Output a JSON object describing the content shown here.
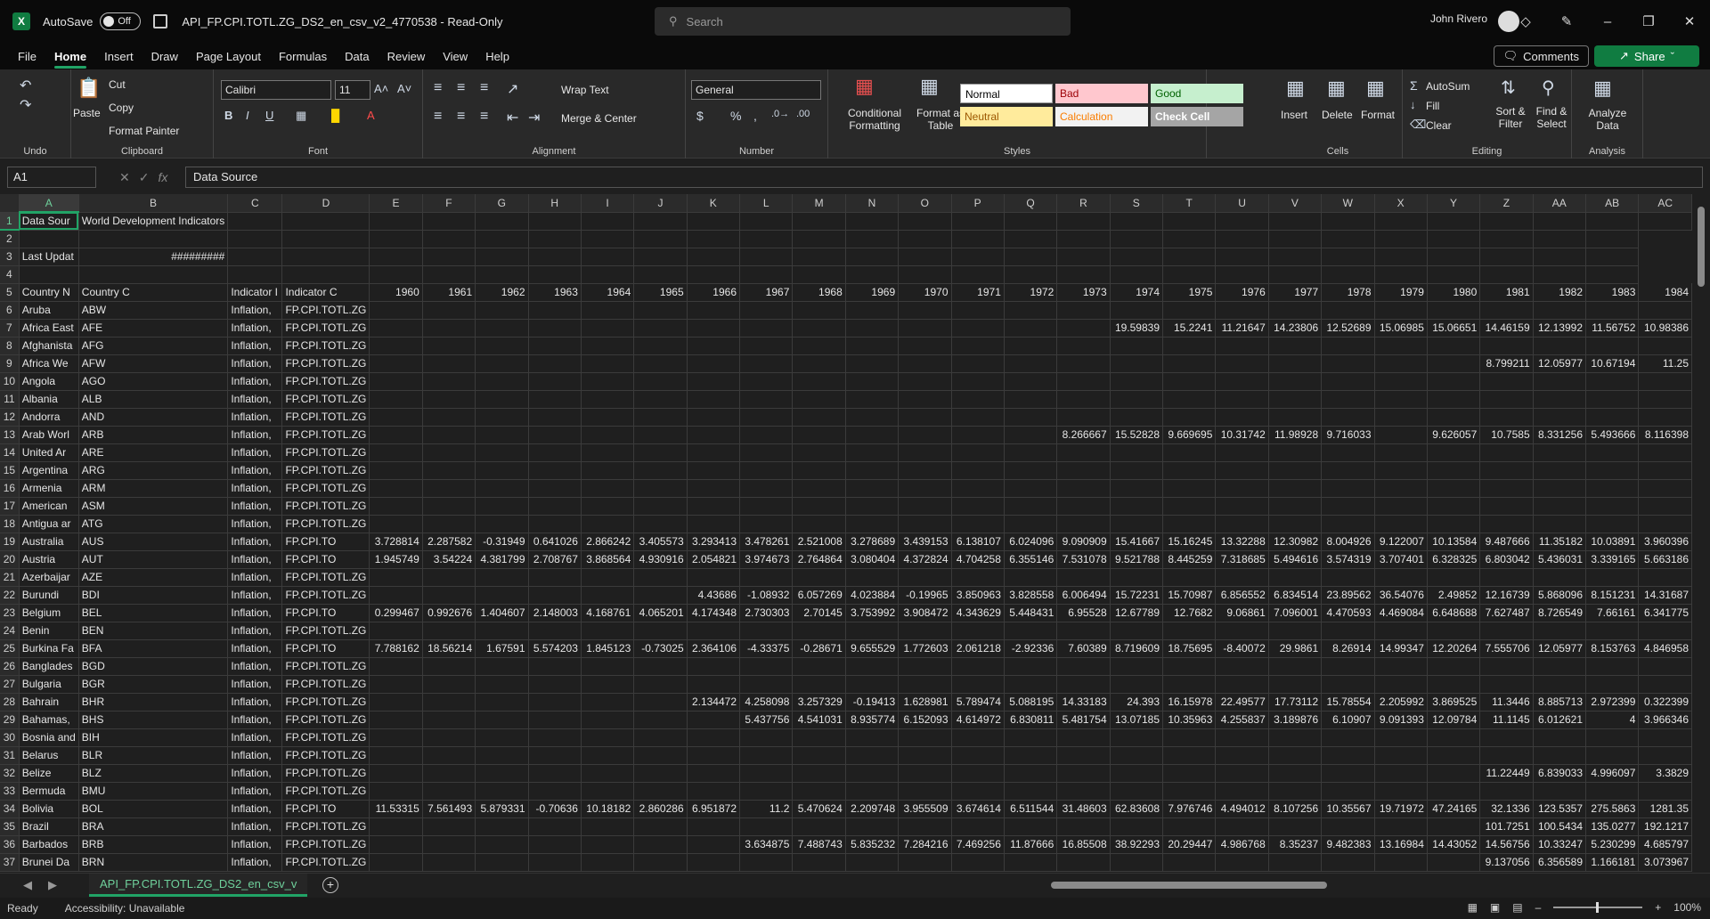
{
  "titlebar": {
    "autosave_label": "AutoSave",
    "autosave_state": "Off",
    "doc_title": "API_FP.CPI.TOTL.ZG_DS2_en_csv_v2_4770538  -  Read-Only",
    "search_placeholder": "Search",
    "user_name": "John Rivero"
  },
  "menu": {
    "tabs": [
      "File",
      "Home",
      "Insert",
      "Draw",
      "Page Layout",
      "Formulas",
      "Data",
      "Review",
      "View",
      "Help"
    ],
    "active": "Home",
    "comments_label": "Comments",
    "share_label": "Share"
  },
  "ribbon": {
    "undo_group": "Undo",
    "clipboard": {
      "paste": "Paste",
      "cut": "Cut",
      "copy": "Copy",
      "format_painter": "Format Painter",
      "label": "Clipboard"
    },
    "font": {
      "name": "Calibri",
      "size": "11",
      "label": "Font"
    },
    "alignment": {
      "wrap": "Wrap Text",
      "merge": "Merge & Center",
      "label": "Alignment"
    },
    "number": {
      "format": "General",
      "label": "Number"
    },
    "styles": {
      "conditional": "Conditional Formatting",
      "format_table": "Format as Table",
      "cells": [
        {
          "name": "Normal",
          "bg": "#ffffff",
          "fg": "#000000"
        },
        {
          "name": "Bad",
          "bg": "#ffc7ce",
          "fg": "#9c0006"
        },
        {
          "name": "Good",
          "bg": "#c6efce",
          "fg": "#006100"
        },
        {
          "name": "Neutral",
          "bg": "#ffeb9c",
          "fg": "#9c5700"
        },
        {
          "name": "Calculation",
          "bg": "#f2f2f2",
          "fg": "#fa7d00"
        },
        {
          "name": "Check Cell",
          "bg": "#a5a5a5",
          "fg": "#ffffff"
        }
      ],
      "label": "Styles"
    },
    "cells": {
      "insert": "Insert",
      "delete": "Delete",
      "format": "Format",
      "label": "Cells"
    },
    "editing": {
      "autosum": "AutoSum",
      "fill": "Fill",
      "clear": "Clear",
      "sort": "Sort & Filter",
      "find": "Find & Select",
      "label": "Editing"
    },
    "analysis": {
      "analyze": "Analyze Data",
      "label": "Analysis"
    }
  },
  "formula_bar": {
    "cell_ref": "A1",
    "content": "Data Source"
  },
  "sheet": {
    "columns": [
      "A",
      "B",
      "C",
      "D",
      "E",
      "F",
      "G",
      "H",
      "I",
      "J",
      "K",
      "L",
      "M",
      "N",
      "O",
      "P",
      "Q",
      "R",
      "S",
      "T",
      "U",
      "V",
      "W",
      "X",
      "Y",
      "Z",
      "AA",
      "AB",
      "AC"
    ],
    "rows": [
      [
        "1",
        "Data Sour",
        "World Development Indicators",
        "",
        "",
        "",
        "",
        "",
        "",
        "",
        "",
        "",
        "",
        "",
        "",
        "",
        "",
        "",
        "",
        "",
        "",
        "",
        "",
        "",
        "",
        "",
        "",
        "",
        "",
        ""
      ],
      [
        "2",
        "",
        "",
        "",
        "",
        "",
        "",
        "",
        "",
        "",
        "",
        "",
        "",
        "",
        "",
        "",
        "",
        "",
        "",
        "",
        "",
        "",
        "",
        "",
        "",
        "",
        "",
        "",
        ""
      ],
      [
        "3",
        "Last Updat",
        "#########",
        "",
        "",
        "",
        "",
        "",
        "",
        "",
        "",
        "",
        "",
        "",
        "",
        "",
        "",
        "",
        "",
        "",
        "",
        "",
        "",
        "",
        "",
        "",
        "",
        "",
        ""
      ],
      [
        "4",
        "",
        "",
        "",
        "",
        "",
        "",
        "",
        "",
        "",
        "",
        "",
        "",
        "",
        "",
        "",
        "",
        "",
        "",
        "",
        "",
        "",
        "",
        "",
        "",
        "",
        "",
        "",
        ""
      ],
      [
        "5",
        "Country N",
        "Country C",
        "Indicator I",
        "Indicator C",
        "1960",
        "1961",
        "1962",
        "1963",
        "1964",
        "1965",
        "1966",
        "1967",
        "1968",
        "1969",
        "1970",
        "1971",
        "1972",
        "1973",
        "1974",
        "1975",
        "1976",
        "1977",
        "1978",
        "1979",
        "1980",
        "1981",
        "1982",
        "1983",
        "1984"
      ],
      [
        "6",
        "Aruba",
        "ABW",
        "Inflation,",
        "FP.CPI.TOTL.ZG",
        "",
        "",
        "",
        "",
        "",
        "",
        "",
        "",
        "",
        "",
        "",
        "",
        "",
        "",
        "",
        "",
        "",
        "",
        "",
        "",
        "",
        "",
        "",
        "",
        ""
      ],
      [
        "7",
        "Africa East",
        "AFE",
        "Inflation,",
        "FP.CPI.TOTL.ZG",
        "",
        "",
        "",
        "",
        "",
        "",
        "",
        "",
        "",
        "",
        "",
        "",
        "",
        "",
        "19.59839",
        "15.2241",
        "11.21647",
        "14.23806",
        "12.52689",
        "15.06985",
        "15.06651",
        "14.46159",
        "12.13992",
        "11.56752",
        "10.98386"
      ],
      [
        "8",
        "Afghanista",
        "AFG",
        "Inflation,",
        "FP.CPI.TOTL.ZG",
        "",
        "",
        "",
        "",
        "",
        "",
        "",
        "",
        "",
        "",
        "",
        "",
        "",
        "",
        "",
        "",
        "",
        "",
        "",
        "",
        "",
        "",
        "",
        "",
        ""
      ],
      [
        "9",
        "Africa We",
        "AFW",
        "Inflation,",
        "FP.CPI.TOTL.ZG",
        "",
        "",
        "",
        "",
        "",
        "",
        "",
        "",
        "",
        "",
        "",
        "",
        "",
        "",
        "",
        "",
        "",
        "",
        "",
        "",
        "",
        "8.799211",
        "12.05977",
        "10.67194",
        "11.25"
      ],
      [
        "10",
        "Angola",
        "AGO",
        "Inflation,",
        "FP.CPI.TOTL.ZG",
        "",
        "",
        "",
        "",
        "",
        "",
        "",
        "",
        "",
        "",
        "",
        "",
        "",
        "",
        "",
        "",
        "",
        "",
        "",
        "",
        "",
        "",
        "",
        "",
        ""
      ],
      [
        "11",
        "Albania",
        "ALB",
        "Inflation,",
        "FP.CPI.TOTL.ZG",
        "",
        "",
        "",
        "",
        "",
        "",
        "",
        "",
        "",
        "",
        "",
        "",
        "",
        "",
        "",
        "",
        "",
        "",
        "",
        "",
        "",
        "",
        "",
        "",
        ""
      ],
      [
        "12",
        "Andorra",
        "AND",
        "Inflation,",
        "FP.CPI.TOTL.ZG",
        "",
        "",
        "",
        "",
        "",
        "",
        "",
        "",
        "",
        "",
        "",
        "",
        "",
        "",
        "",
        "",
        "",
        "",
        "",
        "",
        "",
        "",
        "",
        "",
        ""
      ],
      [
        "13",
        "Arab Worl",
        "ARB",
        "Inflation,",
        "FP.CPI.TOTL.ZG",
        "",
        "",
        "",
        "",
        "",
        "",
        "",
        "",
        "",
        "",
        "",
        "",
        "",
        "8.266667",
        "15.52828",
        "9.669695",
        "10.31742",
        "11.98928",
        "9.716033",
        "",
        "9.626057",
        "10.7585",
        "8.331256",
        "5.493666",
        "8.116398"
      ],
      [
        "14",
        "United Ar",
        "ARE",
        "Inflation,",
        "FP.CPI.TOTL.ZG",
        "",
        "",
        "",
        "",
        "",
        "",
        "",
        "",
        "",
        "",
        "",
        "",
        "",
        "",
        "",
        "",
        "",
        "",
        "",
        "",
        "",
        "",
        "",
        "",
        ""
      ],
      [
        "15",
        "Argentina",
        "ARG",
        "Inflation,",
        "FP.CPI.TOTL.ZG",
        "",
        "",
        "",
        "",
        "",
        "",
        "",
        "",
        "",
        "",
        "",
        "",
        "",
        "",
        "",
        "",
        "",
        "",
        "",
        "",
        "",
        "",
        "",
        "",
        ""
      ],
      [
        "16",
        "Armenia",
        "ARM",
        "Inflation,",
        "FP.CPI.TOTL.ZG",
        "",
        "",
        "",
        "",
        "",
        "",
        "",
        "",
        "",
        "",
        "",
        "",
        "",
        "",
        "",
        "",
        "",
        "",
        "",
        "",
        "",
        "",
        "",
        "",
        ""
      ],
      [
        "17",
        "American",
        "ASM",
        "Inflation,",
        "FP.CPI.TOTL.ZG",
        "",
        "",
        "",
        "",
        "",
        "",
        "",
        "",
        "",
        "",
        "",
        "",
        "",
        "",
        "",
        "",
        "",
        "",
        "",
        "",
        "",
        "",
        "",
        "",
        ""
      ],
      [
        "18",
        "Antigua ar",
        "ATG",
        "Inflation,",
        "FP.CPI.TOTL.ZG",
        "",
        "",
        "",
        "",
        "",
        "",
        "",
        "",
        "",
        "",
        "",
        "",
        "",
        "",
        "",
        "",
        "",
        "",
        "",
        "",
        "",
        "",
        "",
        "",
        ""
      ],
      [
        "19",
        "Australia",
        "AUS",
        "Inflation,",
        "FP.CPI.TO",
        "3.728814",
        "2.287582",
        "-0.31949",
        "0.641026",
        "2.866242",
        "3.405573",
        "3.293413",
        "3.478261",
        "2.521008",
        "3.278689",
        "3.439153",
        "6.138107",
        "6.024096",
        "9.090909",
        "15.41667",
        "15.16245",
        "13.32288",
        "12.30982",
        "8.004926",
        "9.122007",
        "10.13584",
        "9.487666",
        "11.35182",
        "10.03891",
        "3.960396"
      ],
      [
        "20",
        "Austria",
        "AUT",
        "Inflation,",
        "FP.CPI.TO",
        "1.945749",
        "3.54224",
        "4.381799",
        "2.708767",
        "3.868564",
        "4.930916",
        "2.054821",
        "3.974673",
        "2.764864",
        "3.080404",
        "4.372824",
        "4.704258",
        "6.355146",
        "7.531078",
        "9.521788",
        "8.445259",
        "7.318685",
        "5.494616",
        "3.574319",
        "3.707401",
        "6.328325",
        "6.803042",
        "5.436031",
        "3.339165",
        "5.663186"
      ],
      [
        "21",
        "Azerbaijar",
        "AZE",
        "Inflation,",
        "FP.CPI.TOTL.ZG",
        "",
        "",
        "",
        "",
        "",
        "",
        "",
        "",
        "",
        "",
        "",
        "",
        "",
        "",
        "",
        "",
        "",
        "",
        "",
        "",
        "",
        "",
        "",
        "",
        ""
      ],
      [
        "22",
        "Burundi",
        "BDI",
        "Inflation,",
        "FP.CPI.TOTL.ZG",
        "",
        "",
        "",
        "",
        "",
        "",
        "4.43686",
        "-1.08932",
        "6.057269",
        "4.023884",
        "-0.19965",
        "3.850963",
        "3.828558",
        "6.006494",
        "15.72231",
        "15.70987",
        "6.856552",
        "6.834514",
        "23.89562",
        "36.54076",
        "2.49852",
        "12.16739",
        "5.868096",
        "8.151231",
        "14.31687"
      ],
      [
        "23",
        "Belgium",
        "BEL",
        "Inflation,",
        "FP.CPI.TO",
        "0.299467",
        "0.992676",
        "1.404607",
        "2.148003",
        "4.168761",
        "4.065201",
        "4.174348",
        "2.730303",
        "2.70145",
        "3.753992",
        "3.908472",
        "4.343629",
        "5.448431",
        "6.95528",
        "12.67789",
        "12.7682",
        "9.06861",
        "7.096001",
        "4.470593",
        "4.469084",
        "6.648688",
        "7.627487",
        "8.726549",
        "7.66161",
        "6.341775"
      ],
      [
        "24",
        "Benin",
        "BEN",
        "Inflation,",
        "FP.CPI.TOTL.ZG",
        "",
        "",
        "",
        "",
        "",
        "",
        "",
        "",
        "",
        "",
        "",
        "",
        "",
        "",
        "",
        "",
        "",
        "",
        "",
        "",
        "",
        "",
        "",
        "",
        ""
      ],
      [
        "25",
        "Burkina Fa",
        "BFA",
        "Inflation,",
        "FP.CPI.TO",
        "7.788162",
        "18.56214",
        "1.67591",
        "5.574203",
        "1.845123",
        "-0.73025",
        "2.364106",
        "-4.33375",
        "-0.28671",
        "9.655529",
        "1.772603",
        "2.061218",
        "-2.92336",
        "7.60389",
        "8.719609",
        "18.75695",
        "-8.40072",
        "29.9861",
        "8.26914",
        "14.99347",
        "12.20264",
        "7.555706",
        "12.05977",
        "8.153763",
        "4.846958"
      ],
      [
        "26",
        "Banglades",
        "BGD",
        "Inflation,",
        "FP.CPI.TOTL.ZG",
        "",
        "",
        "",
        "",
        "",
        "",
        "",
        "",
        "",
        "",
        "",
        "",
        "",
        "",
        "",
        "",
        "",
        "",
        "",
        "",
        "",
        "",
        "",
        "",
        ""
      ],
      [
        "27",
        "Bulgaria",
        "BGR",
        "Inflation,",
        "FP.CPI.TOTL.ZG",
        "",
        "",
        "",
        "",
        "",
        "",
        "",
        "",
        "",
        "",
        "",
        "",
        "",
        "",
        "",
        "",
        "",
        "",
        "",
        "",
        "",
        "",
        "",
        "",
        ""
      ],
      [
        "28",
        "Bahrain",
        "BHR",
        "Inflation,",
        "FP.CPI.TOTL.ZG",
        "",
        "",
        "",
        "",
        "",
        "",
        "2.134472",
        "4.258098",
        "3.257329",
        "-0.19413",
        "1.628981",
        "5.789474",
        "5.088195",
        "14.33183",
        "24.393",
        "16.15978",
        "22.49577",
        "17.73112",
        "15.78554",
        "2.205992",
        "3.869525",
        "11.3446",
        "8.885713",
        "2.972399",
        "0.322399"
      ],
      [
        "29",
        "Bahamas,",
        "BHS",
        "Inflation,",
        "FP.CPI.TOTL.ZG",
        "",
        "",
        "",
        "",
        "",
        "",
        "",
        "5.437756",
        "4.541031",
        "8.935774",
        "6.152093",
        "4.614972",
        "6.830811",
        "5.481754",
        "13.07185",
        "10.35963",
        "4.255837",
        "3.189876",
        "6.10907",
        "9.091393",
        "12.09784",
        "11.1145",
        "6.012621",
        "4",
        "3.966346"
      ],
      [
        "30",
        "Bosnia and",
        "BIH",
        "Inflation,",
        "FP.CPI.TOTL.ZG",
        "",
        "",
        "",
        "",
        "",
        "",
        "",
        "",
        "",
        "",
        "",
        "",
        "",
        "",
        "",
        "",
        "",
        "",
        "",
        "",
        "",
        "",
        "",
        "",
        ""
      ],
      [
        "31",
        "Belarus",
        "BLR",
        "Inflation,",
        "FP.CPI.TOTL.ZG",
        "",
        "",
        "",
        "",
        "",
        "",
        "",
        "",
        "",
        "",
        "",
        "",
        "",
        "",
        "",
        "",
        "",
        "",
        "",
        "",
        "",
        "",
        "",
        "",
        ""
      ],
      [
        "32",
        "Belize",
        "BLZ",
        "Inflation,",
        "FP.CPI.TOTL.ZG",
        "",
        "",
        "",
        "",
        "",
        "",
        "",
        "",
        "",
        "",
        "",
        "",
        "",
        "",
        "",
        "",
        "",
        "",
        "",
        "",
        "",
        "11.22449",
        "6.839033",
        "4.996097",
        "3.3829"
      ],
      [
        "33",
        "Bermuda",
        "BMU",
        "Inflation,",
        "FP.CPI.TOTL.ZG",
        "",
        "",
        "",
        "",
        "",
        "",
        "",
        "",
        "",
        "",
        "",
        "",
        "",
        "",
        "",
        "",
        "",
        "",
        "",
        "",
        "",
        "",
        "",
        "",
        ""
      ],
      [
        "34",
        "Bolivia",
        "BOL",
        "Inflation,",
        "FP.CPI.TO",
        "11.53315",
        "7.561493",
        "5.879331",
        "-0.70636",
        "10.18182",
        "2.860286",
        "6.951872",
        "11.2",
        "5.470624",
        "2.209748",
        "3.955509",
        "3.674614",
        "6.511544",
        "31.48603",
        "62.83608",
        "7.976746",
        "4.494012",
        "8.107256",
        "10.35567",
        "19.71972",
        "47.24165",
        "32.1336",
        "123.5357",
        "275.5863",
        "1281.35"
      ],
      [
        "35",
        "Brazil",
        "BRA",
        "Inflation,",
        "FP.CPI.TOTL.ZG",
        "",
        "",
        "",
        "",
        "",
        "",
        "",
        "",
        "",
        "",
        "",
        "",
        "",
        "",
        "",
        "",
        "",
        "",
        "",
        "",
        "",
        "101.7251",
        "100.5434",
        "135.0277",
        "192.1217"
      ],
      [
        "36",
        "Barbados",
        "BRB",
        "Inflation,",
        "FP.CPI.TOTL.ZG",
        "",
        "",
        "",
        "",
        "",
        "",
        "",
        "3.634875",
        "7.488743",
        "5.835232",
        "7.284216",
        "7.469256",
        "11.87666",
        "16.85508",
        "38.92293",
        "20.29447",
        "4.986768",
        "8.35237",
        "9.482383",
        "13.16984",
        "14.43052",
        "14.56756",
        "10.33247",
        "5.230299",
        "4.685797"
      ],
      [
        "37",
        "Brunei Da",
        "BRN",
        "Inflation,",
        "FP.CPI.TOTL.ZG",
        "",
        "",
        "",
        "",
        "",
        "",
        "",
        "",
        "",
        "",
        "",
        "",
        "",
        "",
        "",
        "",
        "",
        "",
        "",
        "",
        "",
        "9.137056",
        "6.356589",
        "1.166181",
        "3.073967"
      ]
    ]
  },
  "sheet_tab": "API_FP.CPI.TOTL.ZG_DS2_en_csv_v",
  "status": {
    "ready": "Ready",
    "accessibility": "Accessibility: Unavailable",
    "zoom": "100%"
  }
}
